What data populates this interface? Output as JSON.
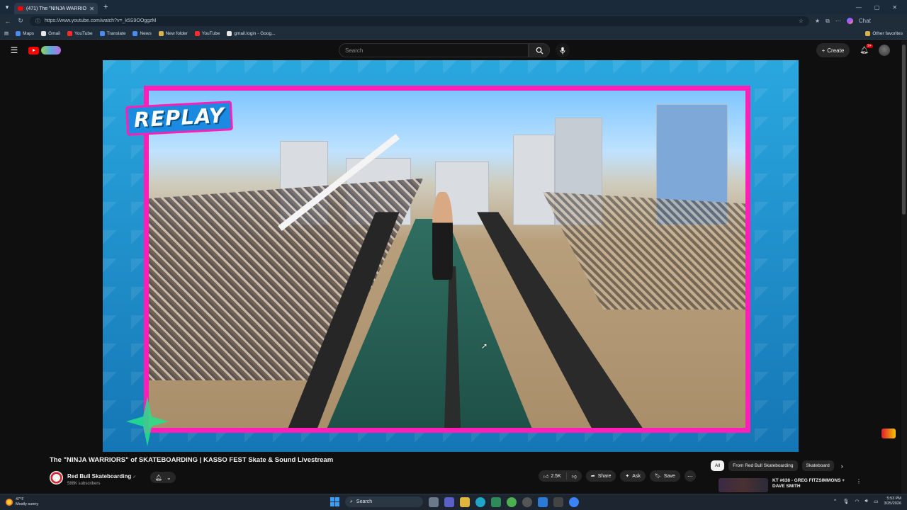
{
  "browser": {
    "tab_title": "(471) The \"NINJA WARRIORS\"",
    "url": "https://www.youtube.com/watch?v=_k5S9OOggzM",
    "copilot_label": "Chat",
    "bookmarks": [
      "Maps",
      "Gmail",
      "YouTube",
      "Translate",
      "News",
      "New folder",
      "YouTube",
      "gmail.login - Goog..."
    ],
    "other_favorites": "Other favorites"
  },
  "youtube": {
    "search_placeholder": "Search",
    "create_label": "Create",
    "notification_count": "9+"
  },
  "video": {
    "overlay_text": "REPLAY",
    "title": "The \"NINJA WARRIORS\" of SKATEBOARDING | KASSO FEST Skate & Sound Livestream",
    "channel_name": "Red Bull Skateboarding",
    "verified_icon": "✓",
    "subscribers": "588K subscribers",
    "likes": "2.5K",
    "share_label": "Share",
    "ask_label": "Ask",
    "save_label": "Save"
  },
  "sidebar": {
    "chips": [
      "All",
      "From Red Bull Skateboarding",
      "Skateboard"
    ],
    "recommendation_title": "KT #638 - GREG FITZSIMMONS + DAVE SMITH"
  },
  "taskbar": {
    "temperature": "47°F",
    "weather_text": "Mostly sunny",
    "search_label": "Search",
    "time": "5:53 PM",
    "date": "3/25/2026"
  },
  "colors": {
    "frame_pink": "#ff1fb6",
    "youtube_red": "#ff0000",
    "replay_blue": "#1a8be0"
  }
}
